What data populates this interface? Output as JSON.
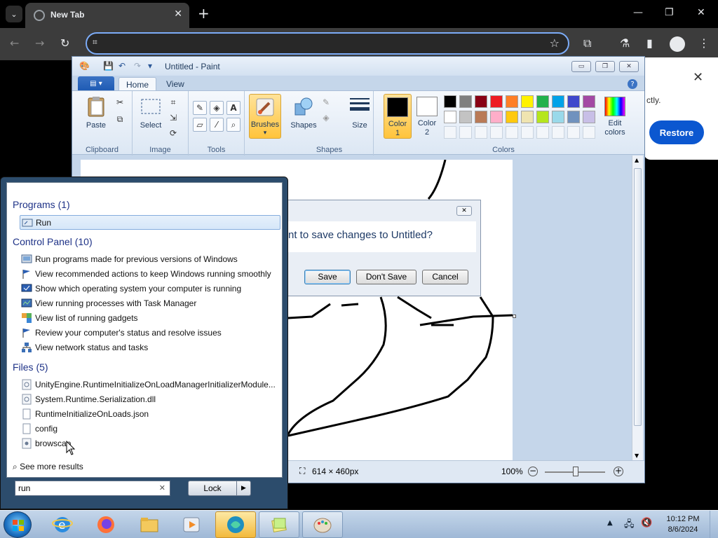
{
  "browser": {
    "tab_title": "New Tab",
    "address_value": "",
    "restore_popup": {
      "text": "ctly.",
      "restore_label": "Restore"
    }
  },
  "paint": {
    "title": "Untitled - Paint",
    "tabs": [
      "Home",
      "View"
    ],
    "groups": {
      "clipboard": {
        "label": "Clipboard",
        "paste": "Paste"
      },
      "image": {
        "label": "Image",
        "select": "Select"
      },
      "tools": {
        "label": "Tools"
      },
      "brushes": {
        "label": "Brushes"
      },
      "shapes": {
        "label": "Shapes",
        "shapes_btn": "Shapes",
        "size": "Size"
      },
      "colors": {
        "label": "Colors",
        "color1": "Color\n1",
        "color2": "Color\n2",
        "edit_colors": "Edit\ncolors"
      }
    },
    "palette_row1": [
      "#000000",
      "#7f7f7f",
      "#880015",
      "#ed1c24",
      "#ff7f27",
      "#fff200",
      "#22b14c",
      "#00a2e8",
      "#3f48cc",
      "#a349a4"
    ],
    "palette_row2": [
      "#ffffff",
      "#c3c3c3",
      "#b97a57",
      "#ffaec9",
      "#ffc90e",
      "#efe4b0",
      "#b5e61d",
      "#99d9ea",
      "#7092be",
      "#c8bfe7"
    ],
    "status": {
      "canvas_size": "614 × 460px",
      "zoom": "100%"
    },
    "save_dialog": {
      "message": "nt to save changes to Untitled?",
      "save": "Save",
      "dont_save": "Don't Save",
      "cancel": "Cancel"
    }
  },
  "start_menu": {
    "programs_header": "Programs (1)",
    "programs": [
      {
        "label": "Run",
        "icon": "run-icon"
      }
    ],
    "control_panel_header": "Control Panel (10)",
    "control_panel": [
      {
        "label": "Run programs made for previous versions of Windows",
        "icon": "compat-icon"
      },
      {
        "label": "View recommended actions to keep Windows running smoothly",
        "icon": "flag-icon"
      },
      {
        "label": "Show which operating system your computer is running",
        "icon": "system-icon"
      },
      {
        "label": "View running processes with Task Manager",
        "icon": "task-manager-icon"
      },
      {
        "label": "View list of running gadgets",
        "icon": "gadgets-icon"
      },
      {
        "label": "Review your computer's status and resolve issues",
        "icon": "flag-icon"
      },
      {
        "label": "View network status and tasks",
        "icon": "network-icon"
      }
    ],
    "files_header": "Files (5)",
    "files": [
      {
        "label": "UnityEngine.RuntimeInitializeOnLoadManagerInitializerModule...",
        "icon": "dll-icon"
      },
      {
        "label": "System.Runtime.Serialization.dll",
        "icon": "dll-icon"
      },
      {
        "label": "RuntimeInitializeOnLoads.json",
        "icon": "file-icon"
      },
      {
        "label": "config",
        "icon": "file-icon"
      },
      {
        "label": "browscap",
        "icon": "settings-file-icon"
      }
    ],
    "see_more": "See more results",
    "search_value": "run",
    "lock_label": "Lock"
  },
  "taskbar": {
    "apps": [
      "internet-explorer-icon",
      "firefox-icon",
      "explorer-icon",
      "media-player-icon",
      "app-icon",
      "sticky-notes-icon",
      "paint-icon"
    ],
    "time": "10:12 PM",
    "date": "8/6/2024"
  }
}
